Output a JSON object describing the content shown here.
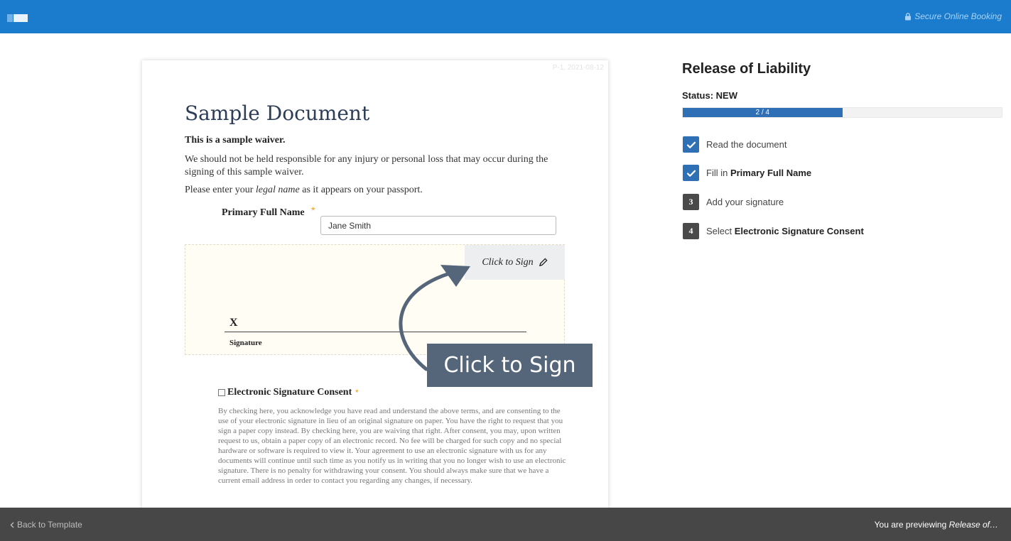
{
  "header": {
    "secure_label": "Secure Online Booking"
  },
  "document": {
    "id_stamp": "P-1, 2021-08-12",
    "title": "Sample Document",
    "subtitle": "This is a sample waiver.",
    "paragraph": "We should not be held responsible for any injury or personal loss that may occur during the signing of this sample waiver.",
    "instruction_before": "Please enter your ",
    "instruction_em": "legal name",
    "instruction_after": " as it appears on your passport.",
    "primary_full_name_label": "Primary Full Name",
    "required_star": "*",
    "primary_full_name_value": "Jane Smith",
    "sign_button_label": "Click to Sign",
    "signature_x": "X",
    "signature_label": "Signature",
    "consent_label": "Electronic Signature Consent",
    "consent_text": "By checking here, you acknowledge you have read and understand the above terms, and are consenting to the use of your electronic signature in lieu of an original signature on paper. You have the right to request that you sign a paper copy instead. By checking here, you are waiving that right. After consent, you may, upon written request to us, obtain a paper copy of an electronic record. No fee will be charged for such copy and no special hardware or software is required to view it. Your agreement to use an electronic signature with us for any documents will continue until such time as you notify us in writing that you no longer wish to use an electronic signature. There is no penalty for withdrawing your consent. You should always make sure that we have a current email address in order to contact you regarding any changes, if necessary."
  },
  "callout": {
    "label": "Click to Sign",
    "color": "#56667a"
  },
  "panel": {
    "title": "Release of Liability",
    "status": "Status: NEW",
    "progress_label": "2 / 4",
    "progress_fraction": 0.5,
    "steps": [
      {
        "state": "done",
        "marker": "",
        "text": "Read the document",
        "bold": ""
      },
      {
        "state": "done",
        "marker": "",
        "text": "Fill in ",
        "bold": "Primary Full Name"
      },
      {
        "state": "todo",
        "marker": "3",
        "text": "Add your signature",
        "bold": ""
      },
      {
        "state": "todo",
        "marker": "4",
        "text": "Select ",
        "bold": "Electronic Signature Consent"
      }
    ]
  },
  "footer": {
    "back_label": "Back to Template",
    "preview_prefix": "You are previewing ",
    "preview_name": "Release of…"
  },
  "colors": {
    "brand": "#1b7ccd",
    "accent": "#2e6fb5",
    "required": "#f39c12",
    "footer": "#474747"
  }
}
